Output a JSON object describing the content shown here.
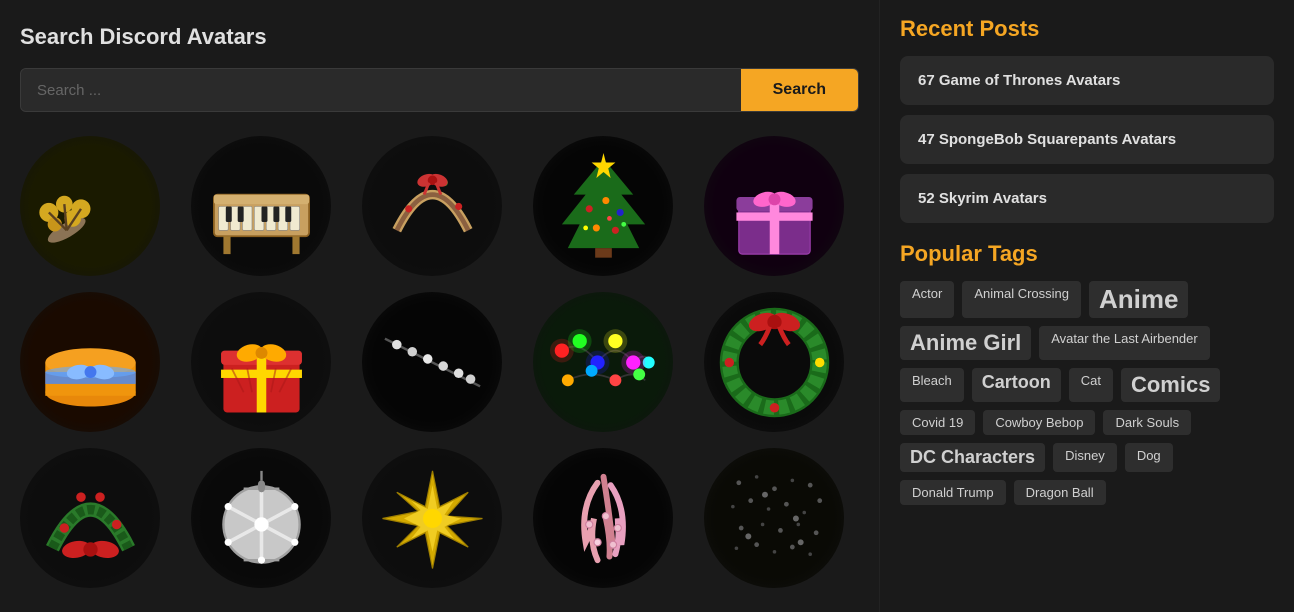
{
  "header": {
    "title": "Search Discord Avatars"
  },
  "search": {
    "placeholder": "Search ...",
    "button_label": "Search"
  },
  "avatars": [
    {
      "id": 1,
      "class": "av1",
      "type": "flower-branch"
    },
    {
      "id": 2,
      "class": "av2",
      "type": "piano"
    },
    {
      "id": 3,
      "class": "av3",
      "type": "wreath-bow"
    },
    {
      "id": 4,
      "class": "av4",
      "type": "christmas-tree"
    },
    {
      "id": 5,
      "class": "av5",
      "type": "gift-purple"
    },
    {
      "id": 6,
      "class": "av6",
      "type": "cake-orange"
    },
    {
      "id": 7,
      "class": "av7",
      "type": "gift-red"
    },
    {
      "id": 8,
      "class": "av8",
      "type": "lights-string"
    },
    {
      "id": 9,
      "class": "av9",
      "type": "lights-colorful"
    },
    {
      "id": 10,
      "class": "av10",
      "type": "wreath-red"
    },
    {
      "id": 11,
      "class": "av11",
      "type": "wreath-christmas"
    },
    {
      "id": 12,
      "class": "av12",
      "type": "ornament-silver"
    },
    {
      "id": 13,
      "class": "av13",
      "type": "star-gold"
    },
    {
      "id": 14,
      "class": "av14",
      "type": "feathers-pink"
    },
    {
      "id": 15,
      "class": "av15",
      "type": "dots-dark"
    }
  ],
  "sidebar": {
    "recent_posts_title": "Recent Posts",
    "posts": [
      {
        "label": "67 Game of Thrones Avatars"
      },
      {
        "label": "47 SpongeBob Squarepants Avatars"
      },
      {
        "label": "52 Skyrim Avatars"
      }
    ],
    "popular_tags_title": "Popular Tags",
    "tags": [
      {
        "label": "Actor",
        "size": "normal"
      },
      {
        "label": "Animal Crossing",
        "size": "normal"
      },
      {
        "label": "Anime",
        "size": "xlarge"
      },
      {
        "label": "Anime Girl",
        "size": "large"
      },
      {
        "label": "Avatar the Last Airbender",
        "size": "normal"
      },
      {
        "label": "Bleach",
        "size": "normal"
      },
      {
        "label": "Cartoon",
        "size": "medium"
      },
      {
        "label": "Cat",
        "size": "normal"
      },
      {
        "label": "Comics",
        "size": "large"
      },
      {
        "label": "Covid 19",
        "size": "normal"
      },
      {
        "label": "Cowboy Bebop",
        "size": "normal"
      },
      {
        "label": "Dark Souls",
        "size": "normal"
      },
      {
        "label": "DC Characters",
        "size": "medium"
      },
      {
        "label": "Disney",
        "size": "normal"
      },
      {
        "label": "Dog",
        "size": "normal"
      },
      {
        "label": "Donald Trump",
        "size": "normal"
      },
      {
        "label": "Dragon Ball",
        "size": "normal"
      }
    ]
  }
}
